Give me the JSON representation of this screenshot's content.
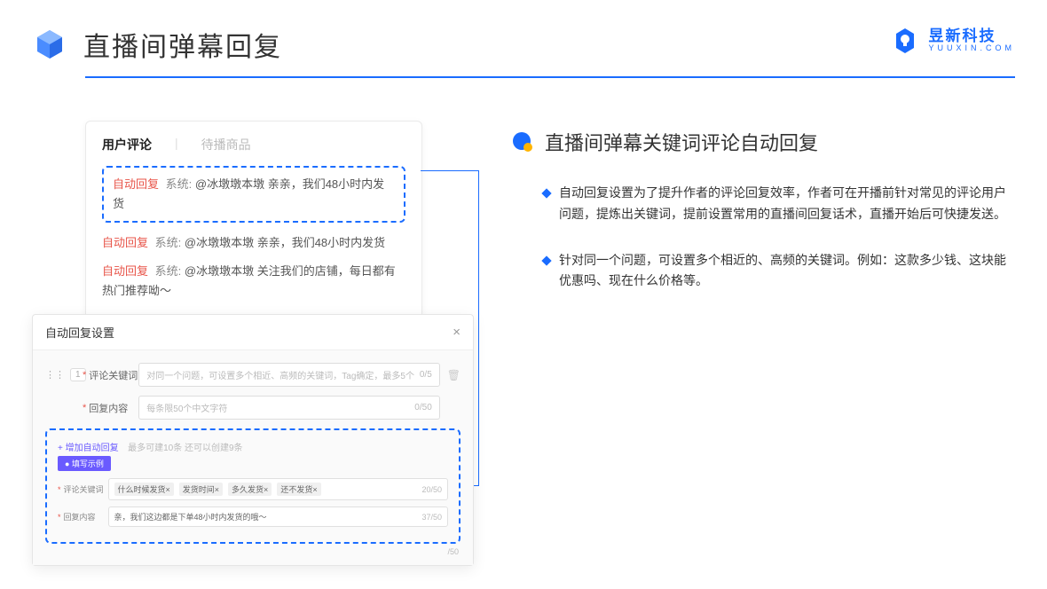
{
  "header": {
    "title": "直播间弹幕回复"
  },
  "logo": {
    "cn": "昱新科技",
    "en": "YUUXIN.COM"
  },
  "comments": {
    "tab1": "用户评论",
    "tab2": "待播商品",
    "auto_label": "自动回复",
    "sys_label": "系统:",
    "row1": "@冰墩墩本墩 亲亲，我们48小时内发货",
    "row2": "@冰墩墩本墩 亲亲，我们48小时内发货",
    "row3": "@冰墩墩本墩 关注我们的店铺，每日都有热门推荐呦～"
  },
  "settings": {
    "title": "自动回复设置",
    "num": "1",
    "kw_label": "评论关键词",
    "kw_placeholder": "对同一个问题，可设置多个相近、高频的关键词，Tag确定，最多5个",
    "kw_counter": "0/5",
    "content_label": "回复内容",
    "content_placeholder": "每条限50个中文字符",
    "content_counter": "0/50",
    "add_link": "+ 增加自动回复",
    "add_hint": "最多可建10条 还可以创建9条",
    "example_badge": "● 填写示例",
    "ex_kw_label": "评论关键词",
    "ex_tags": [
      "什么时候发货×",
      "发货时间×",
      "多久发货×",
      "还不发货×"
    ],
    "ex_kw_counter": "20/50",
    "ex_content_label": "回复内容",
    "ex_content": "亲，我们这边都是下单48小时内发货的哦～",
    "ex_content_counter": "37/50",
    "outer_counter": "/50"
  },
  "section": {
    "title": "直播间弹幕关键词评论自动回复",
    "b1": "自动回复设置为了提升作者的评论回复效率，作者可在开播前针对常见的评论用户问题，提炼出关键词，提前设置常用的直播间回复话术，直播开始后可快捷发送。",
    "b2": "针对同一个问题，可设置多个相近的、高频的关键词。例如：这款多少钱、这块能优惠吗、现在什么价格等。"
  }
}
